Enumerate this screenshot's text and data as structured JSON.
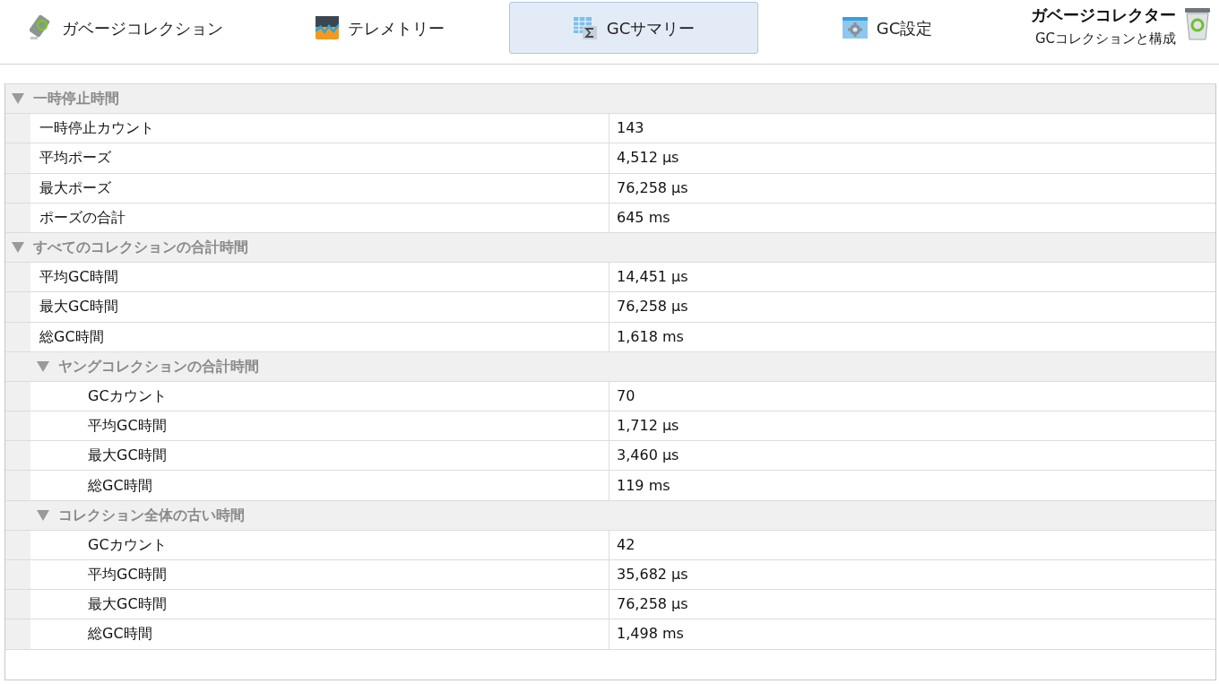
{
  "toolbar": {
    "tabs": [
      {
        "label": "ガベージコレクション",
        "kind": "gc",
        "selected": false
      },
      {
        "label": "テレメトリー",
        "kind": "telemetry",
        "selected": false
      },
      {
        "label": "GCサマリー",
        "kind": "summary",
        "selected": true
      },
      {
        "label": "GC設定",
        "kind": "settings",
        "selected": false
      }
    ],
    "title": "ガベージコレクター",
    "subtitle": "GCコレクションと構成"
  },
  "tree": [
    {
      "label": "一時停止時間",
      "expanded": true,
      "rows": [
        {
          "name": "一時停止カウント",
          "value": "143"
        },
        {
          "name": "平均ポーズ",
          "value": "4,512 µs"
        },
        {
          "name": "最大ポーズ",
          "value": "76,258 µs"
        },
        {
          "name": "ポーズの合計",
          "value": "645 ms"
        }
      ]
    },
    {
      "label": "すべてのコレクションの合計時間",
      "expanded": true,
      "rows": [
        {
          "name": "平均GC時間",
          "value": "14,451 µs"
        },
        {
          "name": "最大GC時間",
          "value": "76,258 µs"
        },
        {
          "name": "総GC時間",
          "value": "1,618 ms"
        }
      ],
      "children": [
        {
          "label": "ヤングコレクションの合計時間",
          "expanded": true,
          "rows": [
            {
              "name": "GCカウント",
              "value": "70"
            },
            {
              "name": "平均GC時間",
              "value": "1,712 µs"
            },
            {
              "name": "最大GC時間",
              "value": "3,460 µs"
            },
            {
              "name": "総GC時間",
              "value": "119 ms"
            }
          ]
        },
        {
          "label": "コレクション全体の古い時間",
          "expanded": true,
          "rows": [
            {
              "name": "GCカウント",
              "value": "42"
            },
            {
              "name": "平均GC時間",
              "value": "35,682 µs"
            },
            {
              "name": "最大GC時間",
              "value": "76,258 µs"
            },
            {
              "name": "総GC時間",
              "value": "1,498 ms"
            }
          ]
        }
      ]
    }
  ]
}
